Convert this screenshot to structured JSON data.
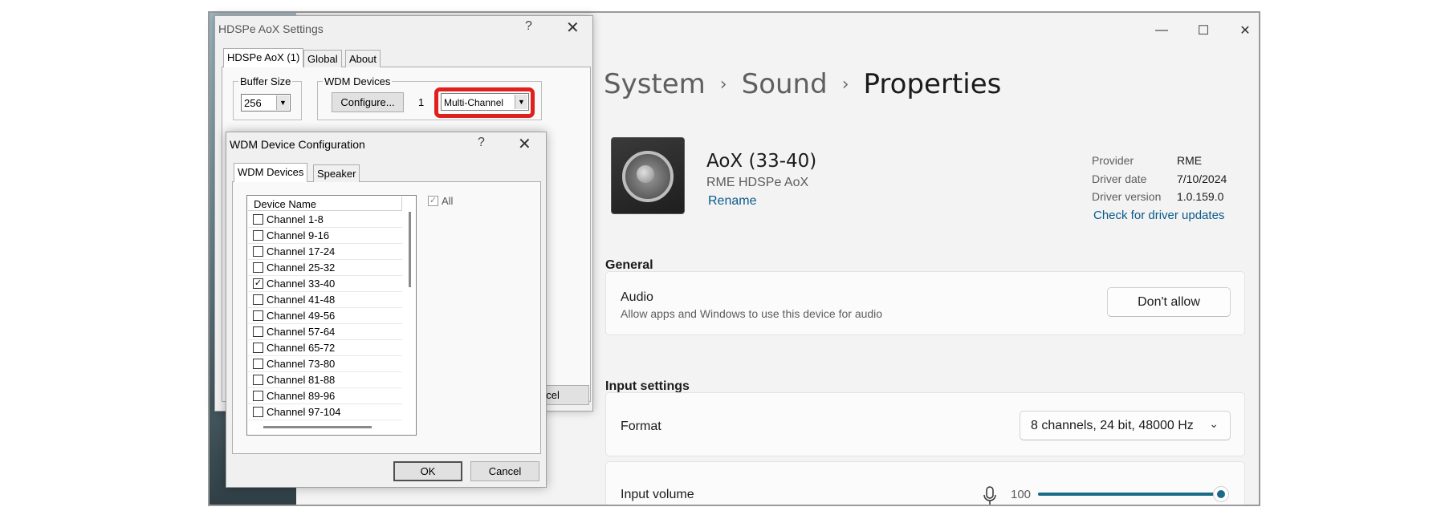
{
  "settings": {
    "breadcrumb": [
      "System",
      "Sound",
      "Properties"
    ],
    "device": {
      "name": "AoX (33-40)",
      "model": "RME HDSPe AoX",
      "rename_label": "Rename"
    },
    "properties": [
      {
        "label": "Provider",
        "value": "RME"
      },
      {
        "label": "Driver date",
        "value": "7/10/2024"
      },
      {
        "label": "Driver version",
        "value": "1.0.159.0"
      }
    ],
    "check_driver_label": "Check for driver updates",
    "general": {
      "title": "General",
      "audio_title": "Audio",
      "audio_desc": "Allow apps and Windows to use this device for audio",
      "dont_allow_label": "Don't allow"
    },
    "input": {
      "title": "Input settings",
      "format_label": "Format",
      "format_value": "8 channels, 24 bit, 48000 Hz",
      "volume_label": "Input volume",
      "volume_value": "100",
      "volume_level": 1.0
    },
    "accent_color": "#1a6a8a"
  },
  "hdspe": {
    "title": "HDSPe AoX Settings",
    "tabs": [
      "HDSPe AoX (1)",
      "Global",
      "About"
    ],
    "buffer_group": "Buffer Size",
    "buffer_value": "256",
    "wdm_group": "WDM Devices",
    "configure_label": "Configure...",
    "wdm_count": "1",
    "mode_value": "Multi-Channel",
    "cancel_partial": "ncel"
  },
  "wdm": {
    "title": "WDM Device Configuration",
    "tabs": [
      "WDM Devices",
      "Speaker"
    ],
    "column_header": "Device Name",
    "all_label": "All",
    "channels": [
      {
        "label": "Channel 1-8",
        "checked": false
      },
      {
        "label": "Channel 9-16",
        "checked": false
      },
      {
        "label": "Channel 17-24",
        "checked": false
      },
      {
        "label": "Channel 25-32",
        "checked": false
      },
      {
        "label": "Channel 33-40",
        "checked": true
      },
      {
        "label": "Channel 41-48",
        "checked": false
      },
      {
        "label": "Channel 49-56",
        "checked": false
      },
      {
        "label": "Channel 57-64",
        "checked": false
      },
      {
        "label": "Channel 65-72",
        "checked": false
      },
      {
        "label": "Channel 73-80",
        "checked": false
      },
      {
        "label": "Channel 81-88",
        "checked": false
      },
      {
        "label": "Channel 89-96",
        "checked": false
      },
      {
        "label": "Channel 97-104",
        "checked": false
      }
    ],
    "ok_label": "OK",
    "cancel_label": "Cancel"
  },
  "icons": {
    "help": "?",
    "close": "✕",
    "minimize": "—",
    "maximize": "☐",
    "chevron_right": "›",
    "chevron_down": "⌄",
    "check": "✓"
  }
}
